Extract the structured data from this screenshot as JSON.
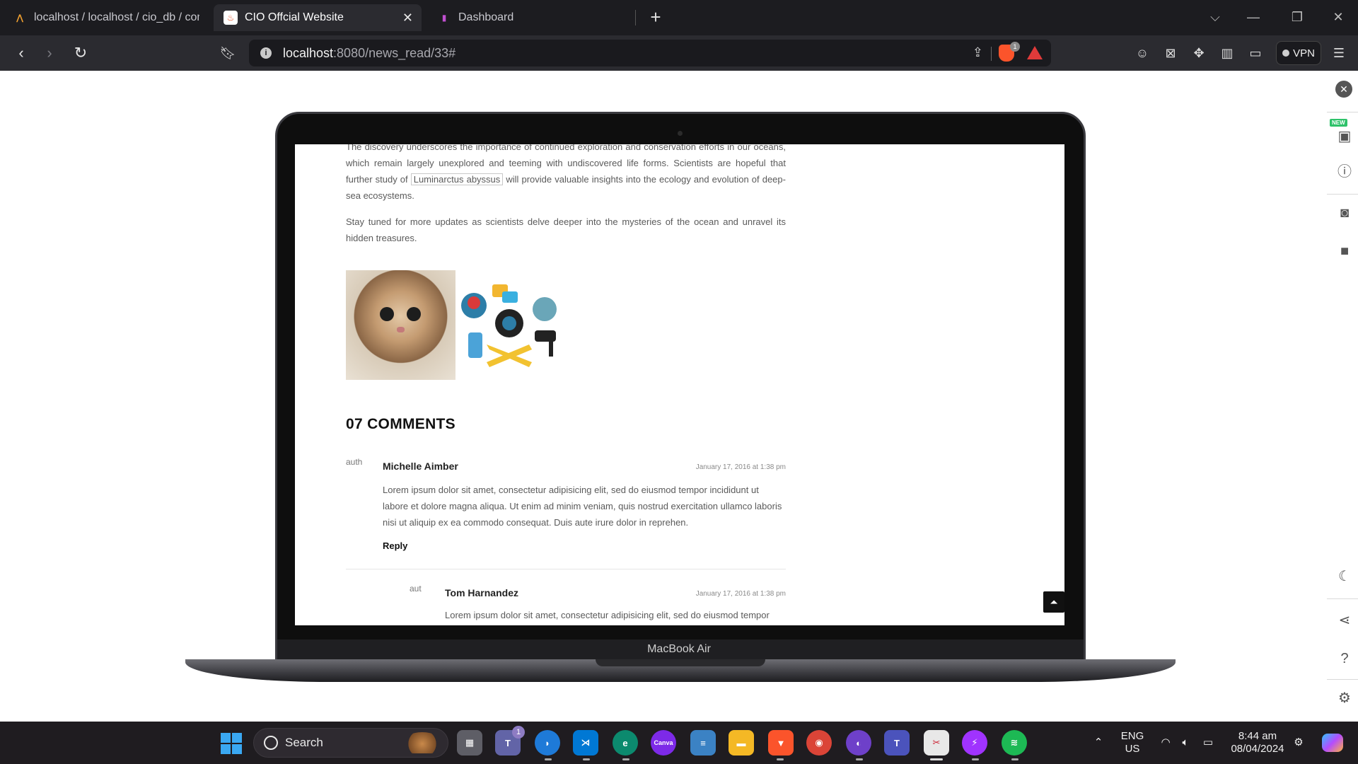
{
  "browser": {
    "tabs": [
      {
        "label": "localhost / localhost / cio_db / comm",
        "favicon": "phpmyadmin-icon"
      },
      {
        "label": "CIO Offcial Website",
        "favicon": "fire-icon",
        "active": true
      },
      {
        "label": "Dashboard",
        "favicon": "dashboard-icon"
      }
    ],
    "url_host": "localhost",
    "url_path": ":8080/news_read/33#",
    "vpn_label": "VPN",
    "shield_count": "1",
    "colors": {
      "tabbar": "#1c1c20",
      "toolbar": "#2b2b30",
      "brave": "#fb542b"
    }
  },
  "article": {
    "paragraphs": [
      "The discovery underscores the importance of continued exploration and conservation efforts in our oceans, which remain largely unexplored and teeming with undiscovered life forms. Scientists are hopeful that further study of",
      "will provide valuable insights into the ecology and evolution of deep-sea ecosystems."
    ],
    "highlight": "Luminarctus abyssus",
    "closing": "Stay tuned for more updates as scientists delve deeper into the mysteries of the ocean and unravel its hidden treasures."
  },
  "comments": {
    "title": "07 COMMENTS",
    "items": [
      {
        "avatar_alt": "auth",
        "name": "Michelle Aimber",
        "date": "January 17, 2016 at 1:38 pm",
        "text": "Lorem ipsum dolor sit amet, consectetur adipisicing elit, sed do eiusmod tempor incididunt ut labore et dolore magna aliqua. Ut enim ad minim veniam, quis nostrud exercitation ullamco laboris nisi ut aliquip ex ea commodo consequat. Duis aute irure dolor in reprehen.",
        "reply_label": "Reply"
      },
      {
        "avatar_alt": "aut",
        "name": "Tom Harnandez",
        "date": "January 17, 2016 at 1:38 pm",
        "text": "Lorem ipsum dolor sit amet, consectetur adipisicing elit, sed do eiusmod tempor"
      }
    ]
  },
  "device_label": "MacBook Air",
  "taskbar": {
    "search_label": "Search",
    "teams_badge": "1",
    "language": "ENG",
    "region": "US",
    "time": "8:44 am",
    "date": "08/04/2024",
    "apps": [
      "file-explorer-icon",
      "teams-icon",
      "copilot-icon",
      "vscode-icon",
      "edge-icon",
      "canva-icon",
      "notepad-icon",
      "folder-icon",
      "brave-icon",
      "chrome-icon",
      "github-icon",
      "teams-work-icon",
      "snipping-tool-icon",
      "messenger-icon",
      "spotify-icon"
    ]
  },
  "side_panel": {
    "new_badge": "NEW"
  }
}
